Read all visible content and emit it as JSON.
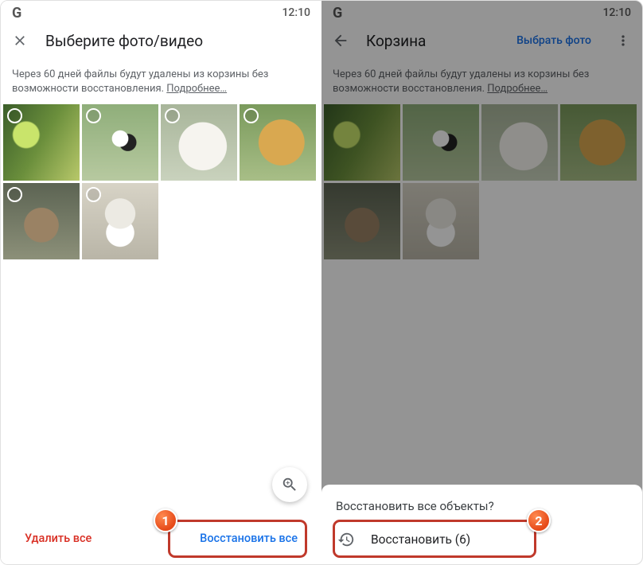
{
  "status": {
    "logo": "G",
    "time": "12:10"
  },
  "left": {
    "title": "Выберите фото/видео",
    "banner": "Через 60 дней файлы будут удалены из корзины без возможности восстановления.",
    "more": "Подробнее…",
    "delete_all": "Удалить все",
    "restore_all": "Восстановить все"
  },
  "right": {
    "title": "Корзина",
    "select_photo": "Выбрать фото",
    "banner": "Через 60 дней файлы будут удалены из корзины без возможности восстановления.",
    "more": "Подробнее…",
    "sheet_title": "Восстановить все объекты?",
    "sheet_action": "Восстановить (6)"
  },
  "steps": {
    "one": "1",
    "two": "2"
  }
}
